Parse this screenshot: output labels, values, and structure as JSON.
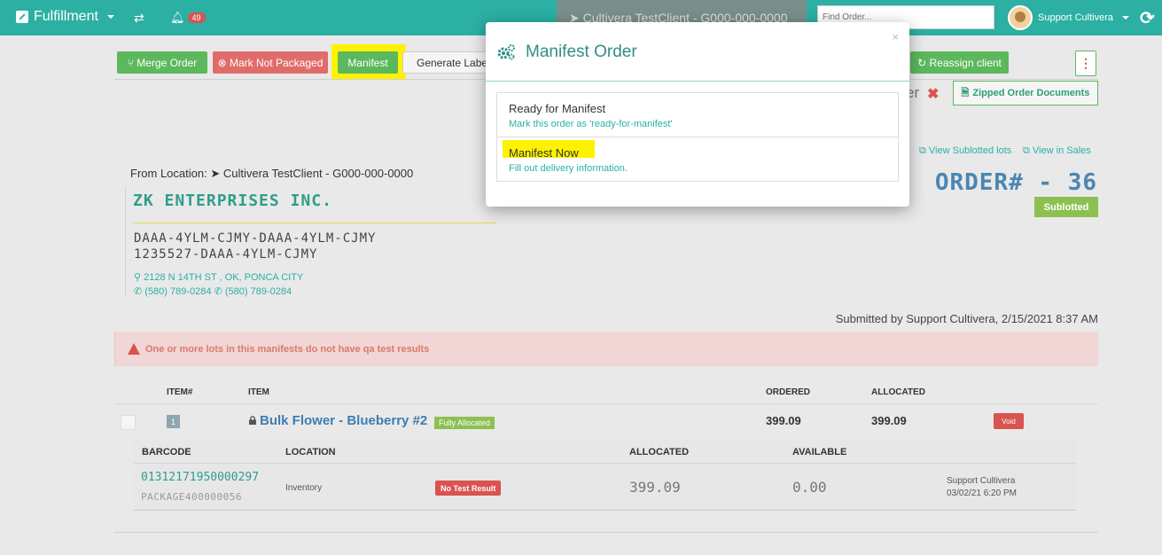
{
  "topbar": {
    "brand": "Fulfillment",
    "notifications_count": "49",
    "client_tab": "Cultivera TestClient - G000-000-0000",
    "find_placeholder": "Find Order...",
    "user_name": "Support Cultivera"
  },
  "toolbar": {
    "merge_label": "Merge Order",
    "not_packaged_label": "Mark Not Packaged",
    "manifest_label": "Manifest",
    "generate_label": "Generate Label",
    "reassign_label": "Reassign client",
    "kebab_label": "⋮"
  },
  "header": {
    "rejected_text": "er",
    "zip_label": "Zipped Order Documents",
    "view_sublotted": "View Sublotted lots",
    "view_in_sales": "View in Sales",
    "order_number": "ORDER# - 36",
    "status": "Sublotted"
  },
  "customer": {
    "from_location_label": "From Location:",
    "from_location_value": "Cultivera TestClient - G000-000-0000",
    "company": "ZK ENTERPRISES INC.",
    "license_line1": "DAAA-4YLM-CJMY-DAAA-4YLM-CJMY",
    "license_line2": "1235527-DAAA-4YLM-CJMY",
    "address": "2128 N 14TH ST , OK, PONCA CITY",
    "phone1": "(580) 789-0284",
    "phone2": "(580) 789-0284"
  },
  "submitted": "Submitted by Support Cultivera, 2/15/2021 8:37 AM",
  "alert": "One or more lots in this manifests do not have qa test results",
  "items_table": {
    "headers": {
      "item_no": "ITEM#",
      "item": "ITEM",
      "ordered": "ORDERED",
      "allocated": "ALLOCATED"
    },
    "rows": [
      {
        "item_no": "1",
        "name": "Bulk Flower - Blueberry #2",
        "badge": "Fully Allocated",
        "ordered": "399.09",
        "allocated": "399.09",
        "void_label": "Void"
      }
    ]
  },
  "lots_table": {
    "headers": {
      "barcode": "BARCODE",
      "location": "LOCATION",
      "allocated": "ALLOCATED",
      "available": "AVAILABLE"
    },
    "rows": [
      {
        "barcode": "01312171950000297",
        "package": "PACKAGE400000056",
        "location": "Inventory",
        "test_status": "No Test Result",
        "allocated": "399.09",
        "available": "0.00",
        "user": "Support Cultivera",
        "date": "03/02/21 6:20 PM"
      }
    ]
  },
  "modal": {
    "title": "Manifest Order",
    "close": "×",
    "options": [
      {
        "title": "Ready for Manifest",
        "desc": "Mark this order as 'ready-for-manifest'"
      },
      {
        "title": "Manifest Now",
        "desc": "Fill out delivery information."
      }
    ]
  },
  "colors": {
    "topbar": "#2bb0a3",
    "success": "#5cb85c",
    "danger": "#d9534f",
    "highlight": "#fff200"
  }
}
